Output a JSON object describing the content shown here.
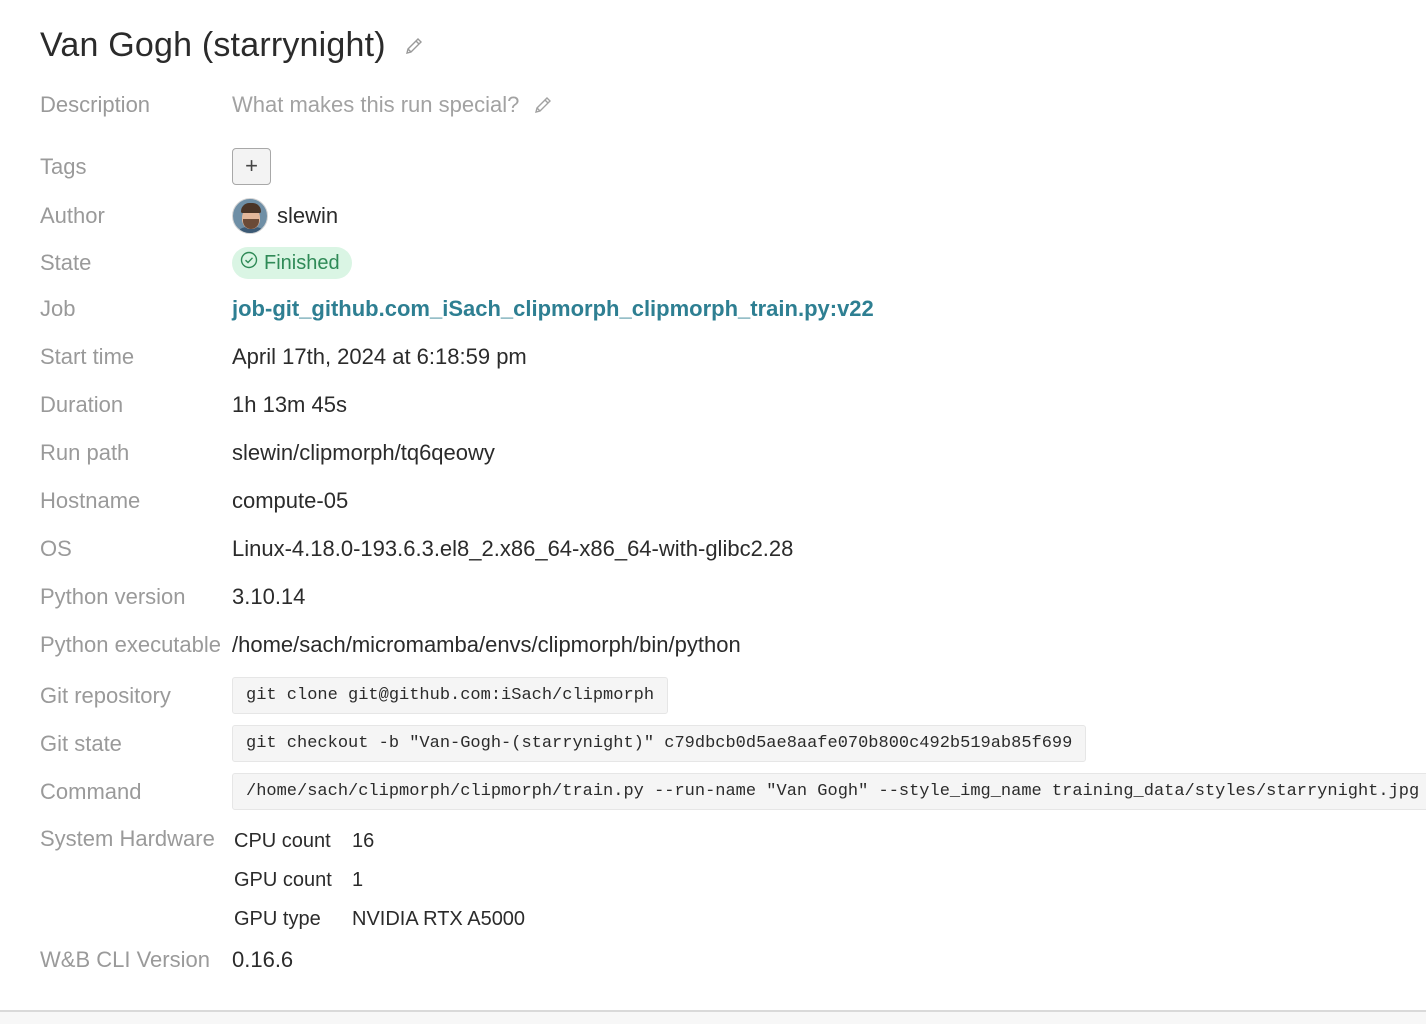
{
  "run": {
    "title": "Van Gogh (starrynight)"
  },
  "labels": {
    "description": "Description",
    "tags": "Tags",
    "author": "Author",
    "state": "State",
    "job": "Job",
    "start_time": "Start time",
    "duration": "Duration",
    "run_path": "Run path",
    "hostname": "Hostname",
    "os": "OS",
    "python_version": "Python version",
    "python_executable": "Python executable",
    "git_repository": "Git repository",
    "git_state": "Git state",
    "command": "Command",
    "system_hardware": "System Hardware",
    "cli_version": "W&B CLI Version"
  },
  "values": {
    "description_placeholder": "What makes this run special?",
    "tags_add": "+",
    "author": "slewin",
    "state": "Finished",
    "job": "job-git_github.com_iSach_clipmorph_clipmorph_train.py:v22",
    "start_time": "April 17th, 2024 at 6:18:59 pm",
    "duration": "1h 13m 45s",
    "run_path": "slewin/clipmorph/tq6qeowy",
    "hostname": "compute-05",
    "os": "Linux-4.18.0-193.6.3.el8_2.x86_64-x86_64-with-glibc2.28",
    "python_version": "3.10.14",
    "python_executable": "/home/sach/micromamba/envs/clipmorph/bin/python",
    "git_repository": "git clone git@github.com:iSach/clipmorph",
    "git_state": "git checkout -b \"Van-Gogh-(starrynight)\" c79dbcb0d5ae8aafe070b800c492b519ab85f699",
    "command": "/home/sach/clipmorph/clipmorph/train.py --run-name \"Van Gogh\" --style_img_name training_data/styles/starrynight.jpg",
    "cli_version": "0.16.6"
  },
  "hardware": [
    {
      "key": "CPU count",
      "value": "16"
    },
    {
      "key": "GPU count",
      "value": "1"
    },
    {
      "key": "GPU type",
      "value": "NVIDIA RTX A5000"
    }
  ],
  "colors": {
    "label": "#9a9a9a",
    "link": "#2e7f92",
    "state_bg": "#daf5e4",
    "state_text": "#2f8a57"
  },
  "icons": {
    "title_edit": "pencil-icon",
    "description_edit": "pencil-icon",
    "state": "check-circle-icon"
  }
}
